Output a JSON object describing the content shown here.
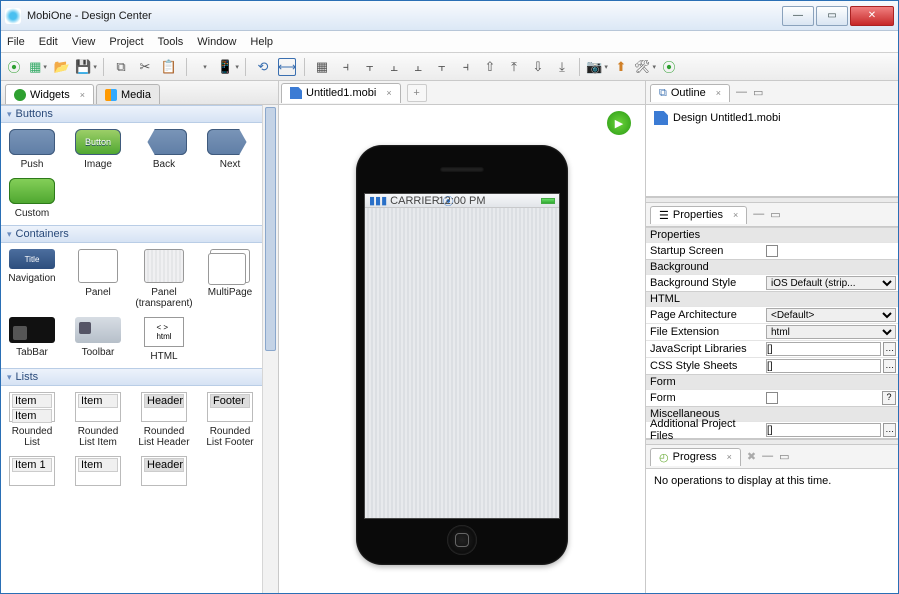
{
  "window": {
    "title": "MobiOne - Design Center"
  },
  "menu": [
    "File",
    "Edit",
    "View",
    "Project",
    "Tools",
    "Window",
    "Help"
  ],
  "left": {
    "tabs": {
      "widgets": "Widgets",
      "media": "Media"
    },
    "sections": {
      "buttons": "Buttons",
      "containers": "Containers",
      "lists": "Lists"
    },
    "buttons": {
      "push": "Push",
      "image": "Image",
      "imageBtnText": "Button",
      "back": "Back",
      "next": "Next",
      "custom": "Custom"
    },
    "containers": {
      "nav": "Navigation",
      "navTitle": "Title",
      "panel": "Panel",
      "panelT": "Panel\n(transparent)",
      "multi": "MultiPage",
      "tabbar": "TabBar",
      "toolbar": "Toolbar",
      "html": "HTML",
      "htmlTag": "< >\nhtml"
    },
    "lists": {
      "rlist": "Rounded List",
      "ritem": "Rounded List Item",
      "rhead": "Rounded List Header",
      "rfoot": "Rounded List Footer",
      "itemText": "Item",
      "headerText": "Header",
      "footerText": "Footer",
      "item1": "Item 1"
    }
  },
  "center": {
    "tab": "Untitled1.mobi",
    "status": {
      "carrier": "CARRIER",
      "time": "12:00 PM"
    }
  },
  "outline": {
    "title": "Outline",
    "root": "Design Untitled1.mobi"
  },
  "properties": {
    "title": "Properties",
    "groups": {
      "properties": "Properties",
      "background": "Background",
      "html": "HTML",
      "form": "Form",
      "misc": "Miscellaneous"
    },
    "rows": {
      "startup": "Startup Screen",
      "bgstyle": "Background Style",
      "bgstyleVal": "iOS Default (strip...",
      "pagearch": "Page Architecture",
      "pagearchVal": "<Default>",
      "fileext": "File Extension",
      "fileextVal": "html",
      "jslibs": "JavaScript Libraries",
      "jslibsVal": "[]",
      "css": "CSS Style Sheets",
      "cssVal": "[]",
      "form": "Form",
      "addfiles": "Additional Project Files",
      "addfilesVal": "[]"
    }
  },
  "progress": {
    "title": "Progress",
    "empty": "No operations to display at this time."
  }
}
